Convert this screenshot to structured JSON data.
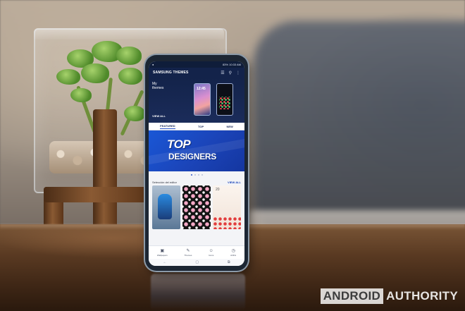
{
  "phone": {
    "status": {
      "time": "10:33 AM",
      "battery": "83%"
    },
    "app_title": "SAMSUNG THEMES",
    "hero": {
      "label": "My themes",
      "view_all": "VIEW ALL",
      "thumb_time": "12:45"
    },
    "tabs": [
      {
        "label": "FEATURED"
      },
      {
        "label": "TOP"
      },
      {
        "label": "NEW"
      }
    ],
    "banner": {
      "line1": "TOP",
      "line2": "DESIGNERS"
    },
    "section": {
      "title": "Selección del editor",
      "view_all": "VIEW ALL"
    },
    "card_3_number": "20",
    "bottom_nav": [
      {
        "label": "Wallpapers",
        "icon": "image-icon"
      },
      {
        "label": "Themes",
        "icon": "brush-icon"
      },
      {
        "label": "Icons",
        "icon": "smiley-icon"
      },
      {
        "label": "AODs",
        "icon": "clock-icon"
      }
    ]
  },
  "watermark": {
    "boxed": "ANDROID",
    "plain": "AUTHORITY"
  }
}
